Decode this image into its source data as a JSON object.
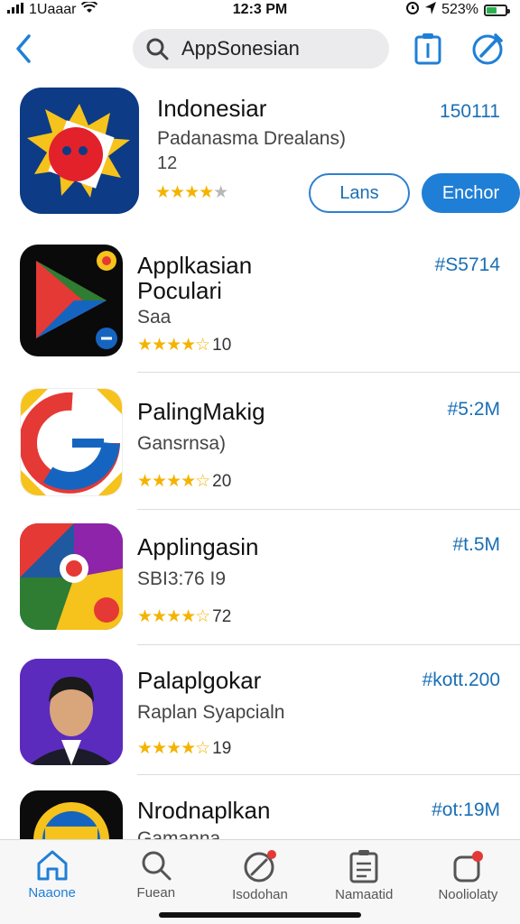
{
  "status_bar": {
    "carrier": "1Uaaar",
    "time": "12:3 PM",
    "battery": "523%"
  },
  "search": {
    "value": "AppSonesian"
  },
  "apps": [
    {
      "title": "Indonesiar",
      "subtitle": "Padanasma Drealans)",
      "meta": "12",
      "rating": 4,
      "rating_count": "",
      "price": "150111",
      "buttons": [
        "Lans",
        "Enchor"
      ]
    },
    {
      "title": "Applkasian",
      "title2": "Poculari",
      "subtitle": "Saa",
      "rating": 4.5,
      "rating_count": "10",
      "price": "#S5714"
    },
    {
      "title": "PalingMakig",
      "subtitle": "Gansrnsa)",
      "rating": 4.5,
      "rating_count": "20",
      "price": "#5:2M"
    },
    {
      "title": "Applingasin",
      "subtitle": "SBI3:76 I9",
      "rating": 4.5,
      "rating_count": "72",
      "price": "#t.5M"
    },
    {
      "title": "Palaplgokar",
      "subtitle": "Raplan Syapcialn",
      "rating": 4.5,
      "rating_count": "19",
      "price": "#kott.200"
    },
    {
      "title": "Nrodnaplkan",
      "subtitle": "Gamanna",
      "price": "#ot:19M"
    }
  ],
  "tabs": [
    {
      "label": "Naaone",
      "icon": "home-icon",
      "active": true
    },
    {
      "label": "Fuean",
      "icon": "search-icon",
      "active": false
    },
    {
      "label": "Isodohan",
      "icon": "compass-icon",
      "active": false
    },
    {
      "label": "Namaatid",
      "icon": "clipboard-icon",
      "active": false
    },
    {
      "label": "Nooliolaty",
      "icon": "notification-icon",
      "active": false
    }
  ],
  "colors": {
    "accent": "#1f7fd6",
    "price": "#1a6fb5",
    "star": "#f5b301",
    "search_bg": "#ebebed"
  }
}
